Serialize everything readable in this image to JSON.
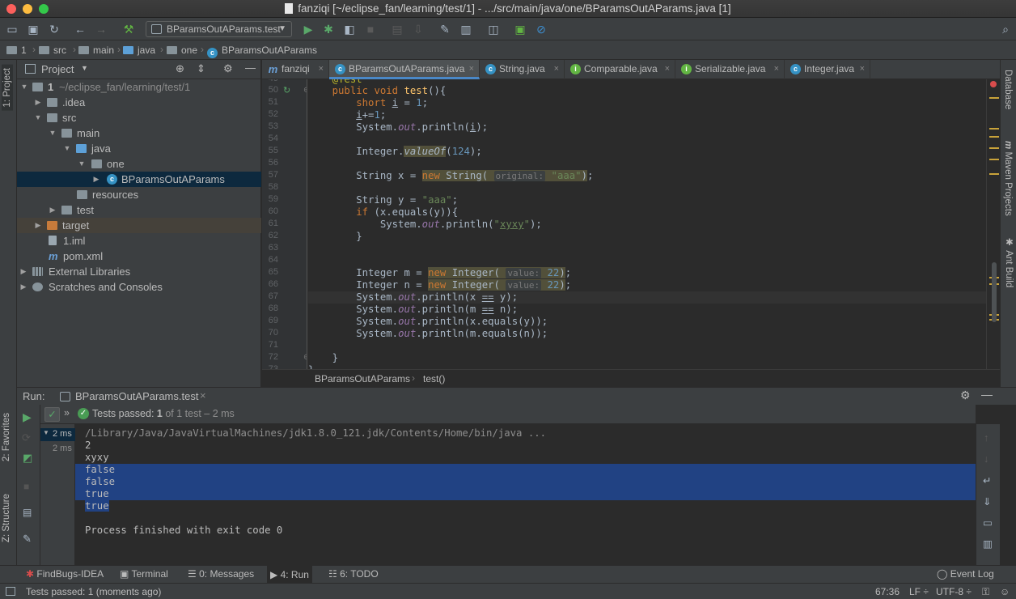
{
  "window": {
    "title": "fanziqi [~/eclipse_fan/learning/test/1] - .../src/main/java/one/BParamsOutAParams.java [1]"
  },
  "toolbar": {
    "run_config": "BParamsOutAParams.test"
  },
  "navbar": {
    "crumbs": [
      "1",
      "src",
      "main",
      "java",
      "one",
      "BParamsOutAParams"
    ]
  },
  "left_tabs": {
    "project": "1: Project",
    "favorites": "2: Favorites",
    "structure": "Z: Structure"
  },
  "right_tabs": {
    "database": "Database",
    "maven": "Maven Projects",
    "ant": "Ant Build"
  },
  "project": {
    "header": "Project",
    "tree": [
      {
        "label": "1",
        "extra": "~/eclipse_fan/learning/test/1"
      },
      {
        "label": ".idea"
      },
      {
        "label": "src"
      },
      {
        "label": "main"
      },
      {
        "label": "java"
      },
      {
        "label": "one"
      },
      {
        "label": "BParamsOutAParams"
      },
      {
        "label": "resources"
      },
      {
        "label": "test"
      },
      {
        "label": "target"
      },
      {
        "label": "1.iml"
      },
      {
        "label": "pom.xml"
      },
      {
        "label": "External Libraries"
      },
      {
        "label": "Scratches and Consoles"
      }
    ]
  },
  "editor": {
    "tabs": [
      {
        "label": "fanziqi",
        "icon": "m"
      },
      {
        "label": "BParamsOutAParams.java",
        "icon": "c",
        "active": true
      },
      {
        "label": "String.java",
        "icon": "c"
      },
      {
        "label": "Comparable.java",
        "icon": "i"
      },
      {
        "label": "Serializable.java",
        "icon": "i"
      },
      {
        "label": "Integer.java",
        "icon": "c"
      }
    ],
    "line_numbers": [
      "49",
      "50",
      "51",
      "52",
      "53",
      "54",
      "55",
      "56",
      "57",
      "58",
      "59",
      "60",
      "61",
      "62",
      "63",
      "64",
      "65",
      "66",
      "67",
      "68",
      "69",
      "70",
      "71",
      "72",
      "73"
    ],
    "hints": {
      "original": "original:",
      "value": "value:"
    },
    "breadcrumb": [
      "BParamsOutAParams",
      "test()"
    ]
  },
  "run": {
    "label": "Run:",
    "tab": "BParamsOutAParams.test",
    "status_prefix": "Tests passed: ",
    "status_count": "1",
    "status_suffix": " of 1 test – 2 ms",
    "tree_time_1": "2 ms",
    "tree_time_2": "2 ms",
    "output": [
      "/Library/Java/JavaVirtualMachines/jdk1.8.0_121.jdk/Contents/Home/bin/java ...",
      "2",
      "xyxy",
      "false",
      "false",
      "true",
      "true",
      "",
      "Process finished with exit code 0"
    ]
  },
  "bottom_tools": {
    "findbugs": "FindBugs-IDEA",
    "terminal": "Terminal",
    "messages": "0: Messages",
    "run": "4: Run",
    "todo": "6: TODO",
    "event_log": "Event Log"
  },
  "status": {
    "message": "Tests passed: 1 (moments ago)",
    "position": "67:36",
    "line_sep": "LF",
    "encoding": "UTF-8"
  },
  "colors": {
    "accent": "#4a88c7",
    "selection": "#214283",
    "passed": "#499c54"
  }
}
